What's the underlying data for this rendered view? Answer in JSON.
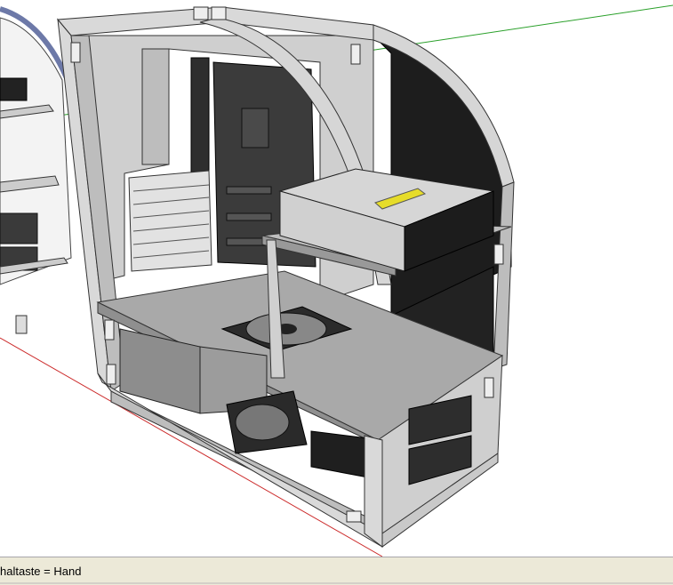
{
  "statusbar": {
    "hint_text": "haltaste = Hand"
  },
  "viewport": {
    "background": "#ffffff",
    "axis_colors": {
      "red": "#cc2b2b",
      "green": "#2aa02a"
    }
  },
  "colors": {
    "frame_light": "#d9d9d9",
    "frame_mid": "#bdbdbd",
    "frame_dark": "#8f8f8f",
    "panel_dark": "#1a1a1a",
    "shelf": "#a9a9a9",
    "board": "#3b3b3b",
    "drive_label": "#e6dc2a"
  }
}
